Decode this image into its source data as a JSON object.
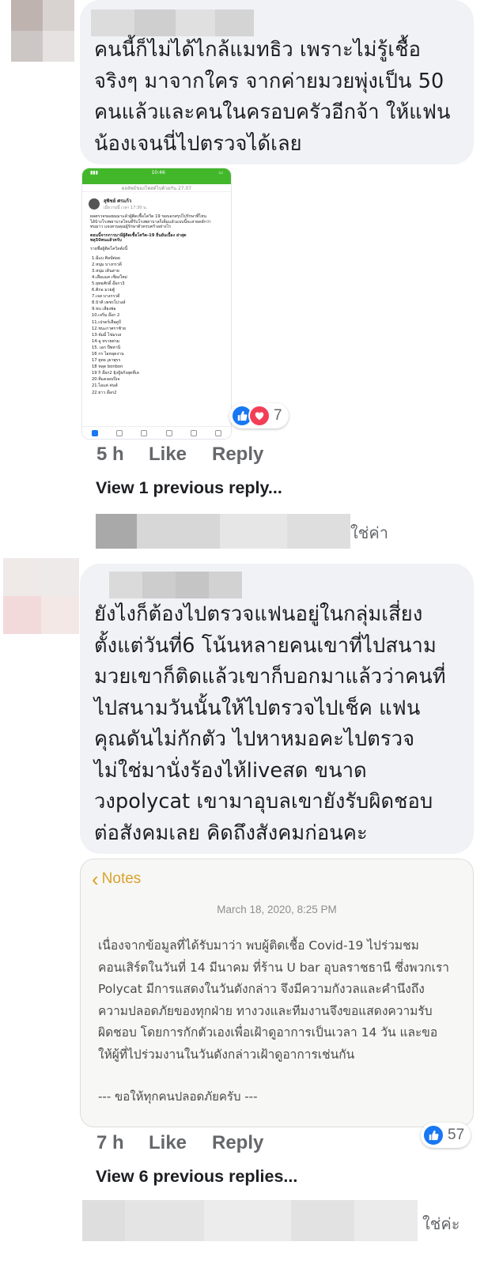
{
  "comments": [
    {
      "text": "คนนี้ก็ไม่ได้ไกล้แมทธิว เพราะไม่รู้เชื้อ\nจริงๆ มาจากใคร จากค่ายมวยพุ่งเป็น 50\nคนแล้วและคนในครอบครัวอีกจ้า ให้แฟน\nน้องเจนนี่ไปตรวจได้เลย",
      "time": "5 h",
      "like_label": "Like",
      "reply_label": "Reply",
      "reaction_count": "7",
      "reactions": [
        "like-icon",
        "love-icon"
      ],
      "view_replies": "View 1 previous reply...",
      "embedded_post": {
        "status_time": "10:46",
        "header": "ผลลัพธ์ของโพสต์ไปด้วยกัน 27.07",
        "author": "สุพิชย์ ศรแก้ว",
        "posted": "เมื่อวานนี้ เวลา 17:30 น.",
        "intro": "ผลตรวจของผมมาแล้วผู้ติดเชื้อโควิด 19 ขอบอกสรุปไปรักษาที่ไหน\nได้บ้างโรงพยาบาลไหนที่รับโรงพยาบาลก็เต็มแล้วแบบนี้จะสายคลักว่า\nทนมาว แจงสวนคุณผู้รักษาตัวครบครัวอย่างไร",
        "highlight": "ตอนนี้จากการมามีผู้ติดเชื้อโควิด-19 ยืนยันเบื้อง ล่าสุด\nพลุ50คนแล้วครับ",
        "list_title": "รายชื่อผู้ติดโควิดดังนี้",
        "list": [
          "1.มีแบ ศิลป์ต่อย",
          "2.หนุ่ม บางกรวดี",
          "3.หนุ่ม เดินสาย",
          "4.เสือแมส เชียงใหม่",
          "5.ยุทธศักดิ์ อ๊อกว3",
          "6.ติกอ มวยตู้",
          "7.เจส บางกรวดี",
          "8.บ้าคิ เพชรโบ่วงส์",
          "9.ขบ เสียงพ่อ",
          "10.เจริ่ม อ๊อก 2",
          "11.เปรดร์เสือดูบี",
          "12.ชนะกาศกาซ้าย",
          "13-จัมมี่ ไข่มรงง",
          "14-อู ทรายต่วม",
          "15. เอก ปีพหานี",
          "16 กร ไอหลุดงาน",
          "17 ยุทธ เุยาพุรร",
          "18 หลุด bonbon",
          "19 กิ อ๊อก2 ยุ้งปู้ยกังสุดที่เล",
          "20.ทีแดงอบปีเจ",
          "21.ไอแค่ ค่นส์",
          "22.ยาว อ๊อก2"
        ]
      }
    },
    {
      "trailing": "ใช่ค่า"
    },
    {
      "text": "ยังไงก็ต้องไปตรวจแฟนอยู่ในกลุ่มเสี่ยง\nตั้งแต่วันที่6 โน้นหลายคนเขาที่ไปสนาม\nมวยเขาก็ติดแล้วเขาก็บอกมาแล้วว่าคนที่\nไปสนามวันนั้นให้ไปตรวจไปเช็ค แฟน\nคุณดันไม่กักตัว ไปหาหมอคะไปตรวจ\nไม่ใช่มานั่งร้องไห้liveสด ขนาด\nวงpolycat เขามาอุบลเขายังรับผิดชอบ\nต่อสังคมเลย คิดถึงสังคมก่อนคะ",
      "time": "7 h",
      "like_label": "Like",
      "reply_label": "Reply",
      "reaction_count": "57",
      "reactions": [
        "like-icon"
      ],
      "view_replies": "View 6 previous replies...",
      "notes": {
        "back_label": "Notes",
        "date": "March 18, 2020, 8:25 PM",
        "body": "เนื่องจากข้อมูลที่ได้รับมาว่า พบผู้ติดเชื้อ Covid-19 ไปร่วมชม\nคอนเสิร์ตในวันที่ 14 มีนาคม ที่ร้าน U bar อุบลราชธานี ซึ่งพวกเรา\nPolycat มีการแสดงในวันดังกล่าว จึงมีความกังวลและคำนึงถึง\nความปลอดภัยของทุกฝ่าย ทางวงและทีมงานจึงขอแสดงความรับ\nผิดชอบ โดยการกักตัวเองเพื่อเฝ้าดูอาการเป็นเวลา 14 วัน และขอ\nให้ผู้ที่ไปร่วมงานในวันดังกล่าวเฝ้าดูอาการเช่นกัน",
        "footer": "--- ขอให้ทุกคนปลอดภัยครับ ---"
      }
    },
    {
      "trailing": "ใช่ค่ะ"
    }
  ],
  "colors": {
    "bubble": "#f0f2f5",
    "like_blue": "#1877f2",
    "love_red": "#f33e58",
    "notes_accent": "#d9a22c",
    "meta_gray": "#65676b"
  }
}
